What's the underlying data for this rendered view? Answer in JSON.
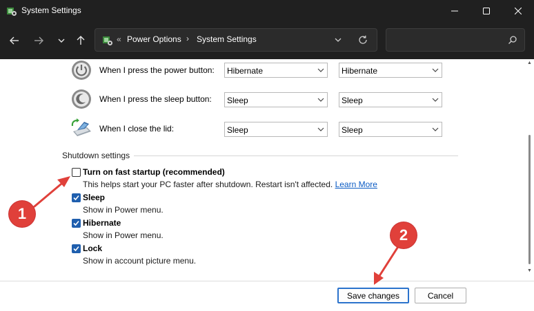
{
  "window": {
    "title": "System Settings"
  },
  "address_bar": {
    "separator_leading": "«",
    "crumbs": [
      "Power Options",
      "System Settings"
    ],
    "crumb_separator": "›"
  },
  "search": {
    "placeholder": ""
  },
  "power_rows": [
    {
      "label": "When I press the power button:",
      "on_battery": "Hibernate",
      "plugged_in": "Hibernate",
      "icon": "power-button-icon"
    },
    {
      "label": "When I press the sleep button:",
      "on_battery": "Sleep",
      "plugged_in": "Sleep",
      "icon": "sleep-button-icon"
    },
    {
      "label": "When I close the lid:",
      "on_battery": "Sleep",
      "plugged_in": "Sleep",
      "icon": "laptop-lid-icon"
    }
  ],
  "shutdown": {
    "title": "Shutdown settings",
    "options": [
      {
        "label": "Turn on fast startup (recommended)",
        "description": "This helps start your PC faster after shutdown. Restart isn't affected.",
        "link": "Learn More",
        "checked": false
      },
      {
        "label": "Sleep",
        "description": "Show in Power menu.",
        "checked": true
      },
      {
        "label": "Hibernate",
        "description": "Show in Power menu.",
        "checked": true
      },
      {
        "label": "Lock",
        "description": "Show in account picture menu.",
        "checked": true
      }
    ]
  },
  "buttons": {
    "save": "Save changes",
    "cancel": "Cancel"
  },
  "annotations": {
    "badge_1": "1",
    "badge_2": "2",
    "color": "#e0403a"
  },
  "colors": {
    "titlebar": "#202020",
    "checkbox_checked": "#1f5fae",
    "link": "#0a5bc4"
  }
}
